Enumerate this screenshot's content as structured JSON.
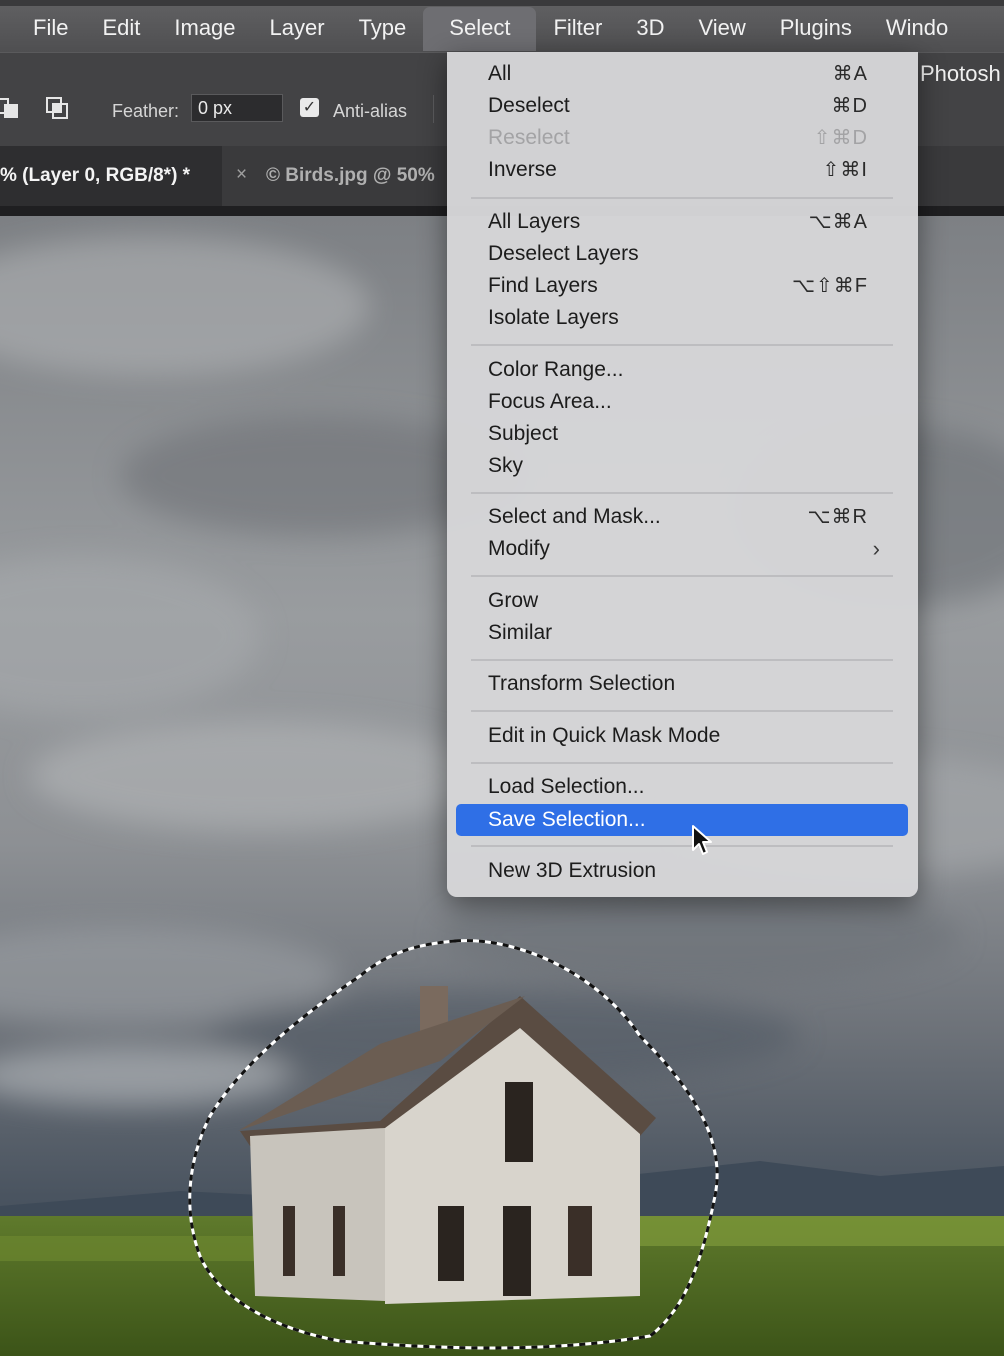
{
  "menubar": {
    "items": [
      "File",
      "Edit",
      "Image",
      "Layer",
      "Type",
      "Select",
      "Filter",
      "3D",
      "View",
      "Plugins",
      "Windo"
    ],
    "active": "Select"
  },
  "options": {
    "feather_label": "Feather:",
    "feather_value": "0 px",
    "antialias_label": "Anti-alias",
    "antialias_checked": true,
    "right_label": "Photosh"
  },
  "tabs": {
    "active_title": "% (Layer 0, RGB/8*) *",
    "close_symbol": "×",
    "second_title": "© Birds.jpg @ 50%"
  },
  "select_menu": {
    "items": [
      {
        "label": "All",
        "shortcut": "⌘A"
      },
      {
        "label": "Deselect",
        "shortcut": "⌘D"
      },
      {
        "label": "Reselect",
        "shortcut": "⇧⌘D",
        "disabled": true
      },
      {
        "label": "Inverse",
        "shortcut": "⇧⌘I"
      },
      {
        "label": "All Layers",
        "shortcut": "⌥⌘A"
      },
      {
        "label": "Deselect Layers",
        "shortcut": ""
      },
      {
        "label": "Find Layers",
        "shortcut": "⌥⇧⌘F"
      },
      {
        "label": "Isolate Layers",
        "shortcut": ""
      },
      {
        "label": "Color Range...",
        "shortcut": ""
      },
      {
        "label": "Focus Area...",
        "shortcut": ""
      },
      {
        "label": "Subject",
        "shortcut": ""
      },
      {
        "label": "Sky",
        "shortcut": ""
      },
      {
        "label": "Select and Mask...",
        "shortcut": "⌥⌘R"
      },
      {
        "label": "Modify",
        "shortcut": "",
        "submenu": true
      },
      {
        "label": "Grow",
        "shortcut": ""
      },
      {
        "label": "Similar",
        "shortcut": ""
      },
      {
        "label": "Transform Selection",
        "shortcut": ""
      },
      {
        "label": "Edit in Quick Mask Mode",
        "shortcut": ""
      },
      {
        "label": "Load Selection...",
        "shortcut": ""
      },
      {
        "label": "Save Selection...",
        "shortcut": "",
        "highlighted": true
      },
      {
        "label": "New 3D Extrusion",
        "shortcut": ""
      }
    ],
    "submenu_glyph": "›",
    "highlight_color": "#2f6fe6"
  },
  "icons": [
    "combine-selection-icon",
    "subtract-selection-icon",
    "checkbox-check-icon",
    "tab-close-icon",
    "submenu-arrow-icon",
    "mouse-pointer-icon"
  ]
}
